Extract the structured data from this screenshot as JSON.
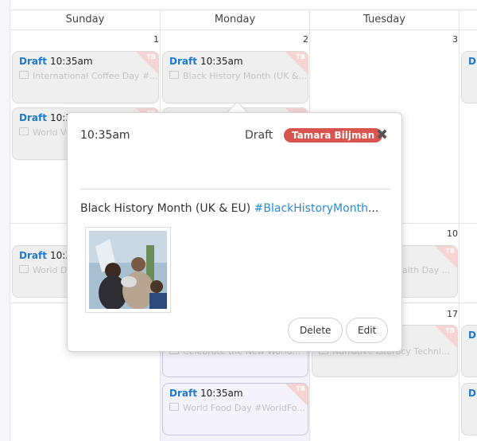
{
  "calendar": {
    "days": [
      "Sunday",
      "Monday",
      "Tuesday"
    ],
    "day_numbers": {
      "sun_r1": "1",
      "mon_r1": "2",
      "tue_r1": "3",
      "tue_r2": "10",
      "tue_r3": "17"
    },
    "cards": {
      "c1": {
        "status": "Draft",
        "time": "10:35am",
        "title": "International Coffee Day #...",
        "initials": "TB"
      },
      "c2": {
        "status": "Draft",
        "time": "10:35am",
        "title": "Black History Month (UK &...",
        "initials": "TB"
      },
      "c3": {
        "status": "Draft",
        "time": "10:35am",
        "title": "World Ve",
        "initials": "TB"
      },
      "c4": {
        "status": "Draft",
        "time": "10:35am",
        "title": "World D",
        "initials": "TB"
      },
      "c5": {
        "title": "alth Day ...",
        "initials": "TB"
      },
      "c6": {
        "title": "Celebrate the New World...",
        "initials": "TB"
      },
      "c7": {
        "title": "Narrative Literacy Techni...",
        "initials": "TB"
      },
      "c8": {
        "status": "Draft",
        "time": "10:35am",
        "title": "World Food Day #WorldFo...",
        "initials": "TB"
      },
      "c9": {
        "status": "Dr",
        "initials": "TB"
      },
      "c10": {
        "status": "Dr",
        "initials": "TB"
      },
      "c11": {
        "status": "Dr",
        "initials": "TB"
      }
    }
  },
  "popover": {
    "time": "10:35am",
    "status": "Draft",
    "assignee": "Tamara Biljman",
    "close_glyph": "✖",
    "text_plain": "Black History Month (UK & EU) ",
    "text_hashtag": "#BlackHistoryMonth",
    "text_ellipsis": "...",
    "delete_label": "Delete",
    "edit_label": "Edit"
  },
  "colors": {
    "accent_blue": "#1f7ad1",
    "badge_red": "#d9534f",
    "hashtag_blue": "#2a8ad6"
  }
}
